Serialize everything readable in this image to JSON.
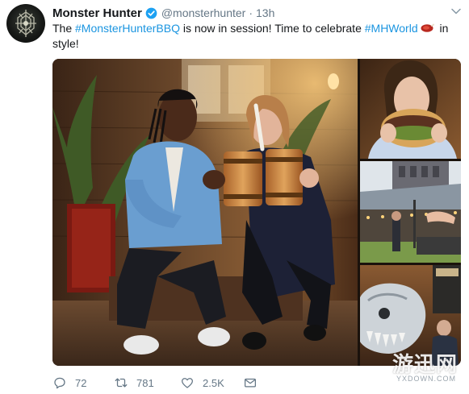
{
  "tweet": {
    "display_name": "Monster Hunter",
    "handle": "@monsterhunter",
    "separator": "·",
    "timestamp": "13h",
    "text": {
      "part1": "The ",
      "hashtag1": "#MonsterHunterBBQ",
      "part2": " is now in session! Time to celebrate ",
      "hashtag2": "#MHWorld",
      "part3": " in style!"
    },
    "colors": {
      "hashtag": "#1b95e0",
      "verified": "#1da1f2",
      "meta": "#657786"
    }
  },
  "media": {
    "photos": [
      {
        "icon": "two-people-toasting-wooden-tankards-photo"
      },
      {
        "icon": "woman-eating-burger-photo"
      },
      {
        "icon": "outdoor-bbq-roasting-photo"
      },
      {
        "icon": "monster-skull-statue-photo"
      }
    ]
  },
  "actions": {
    "reply_count": "72",
    "retweet_count": "781",
    "like_count": "2.5K"
  },
  "watermark": {
    "big": "游迅网",
    "small": "YXDOWN.COM"
  }
}
